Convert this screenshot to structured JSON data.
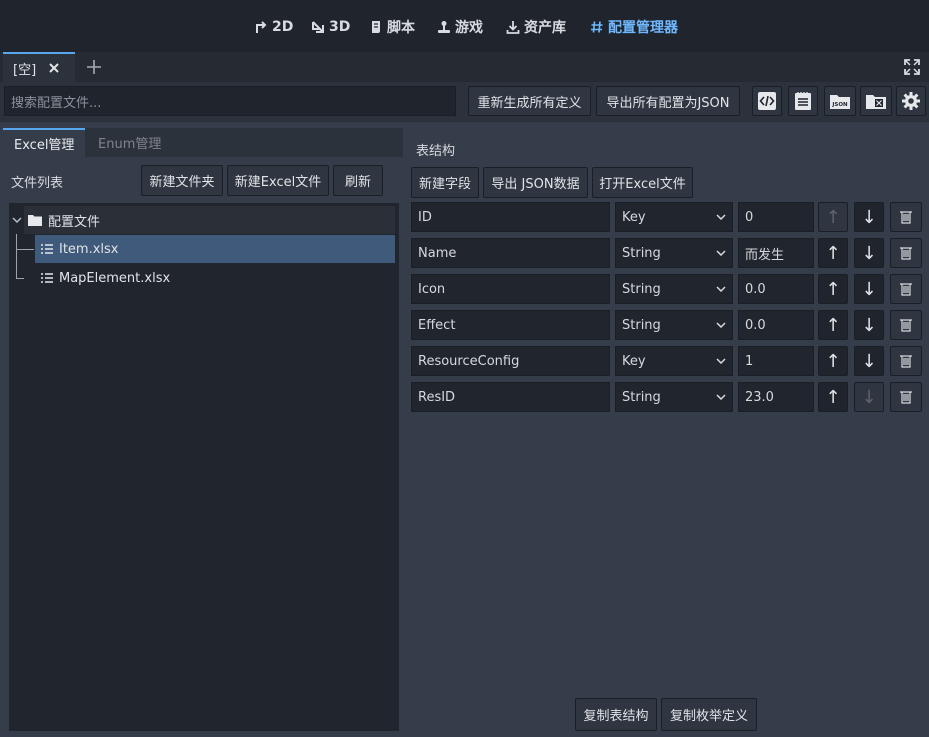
{
  "top_modes": [
    {
      "label": "2D",
      "icon": "2d-transform-icon",
      "active": false
    },
    {
      "label": "3D",
      "icon": "3d-transform-icon",
      "active": false
    },
    {
      "label": "脚本",
      "icon": "script-icon",
      "active": false
    },
    {
      "label": "游戏",
      "icon": "joystick-icon",
      "active": false
    },
    {
      "label": "资产库",
      "icon": "download-icon",
      "active": false
    },
    {
      "label": "配置管理器",
      "icon": "hash-icon",
      "active": true
    }
  ],
  "doc_tab": {
    "label": "[空]"
  },
  "toolbar": {
    "search_placeholder": "搜索配置文件...",
    "regen_label": "重新生成所有定义",
    "export_all_label": "导出所有配置为JSON",
    "icons": [
      "code-icon",
      "notepad-icon",
      "json-folder-icon",
      "excel-folder-icon",
      "gear-icon"
    ]
  },
  "left": {
    "tabs": [
      {
        "label": "Excel管理",
        "active": true
      },
      {
        "label": "Enum管理",
        "active": false
      }
    ],
    "file_list_label": "文件列表",
    "btn_new_folder": "新建文件夹",
    "btn_new_excel": "新建Excel文件",
    "btn_refresh": "刷新",
    "tree": {
      "root": "配置文件",
      "children": [
        {
          "label": "Item.xlsx",
          "selected": true
        },
        {
          "label": "MapElement.xlsx",
          "selected": false
        }
      ]
    }
  },
  "right": {
    "title": "表结构",
    "btn_new_field": "新建字段",
    "btn_export_json": "导出 JSON数据",
    "btn_open_excel": "打开Excel文件",
    "fields": [
      {
        "name": "ID",
        "type": "Key",
        "default": "0",
        "up_enabled": false,
        "down_enabled": true
      },
      {
        "name": "Name",
        "type": "String",
        "default": "而发生",
        "up_enabled": true,
        "down_enabled": true
      },
      {
        "name": "Icon",
        "type": "String",
        "default": "0.0",
        "up_enabled": true,
        "down_enabled": true
      },
      {
        "name": "Effect",
        "type": "String",
        "default": "0.0",
        "up_enabled": true,
        "down_enabled": true
      },
      {
        "name": "ResourceConfig",
        "type": "Key",
        "default": "1",
        "up_enabled": true,
        "down_enabled": true
      },
      {
        "name": "ResID",
        "type": "String",
        "default": "23.0",
        "up_enabled": true,
        "down_enabled": false
      }
    ],
    "btn_copy_struct": "复制表结构",
    "btn_copy_enum": "复制枚举定义"
  },
  "colors": {
    "accent": "#6fb8ff",
    "bg": "#363d4a",
    "topbar": "#1f242d",
    "selected_row": "#3f5a7a"
  }
}
